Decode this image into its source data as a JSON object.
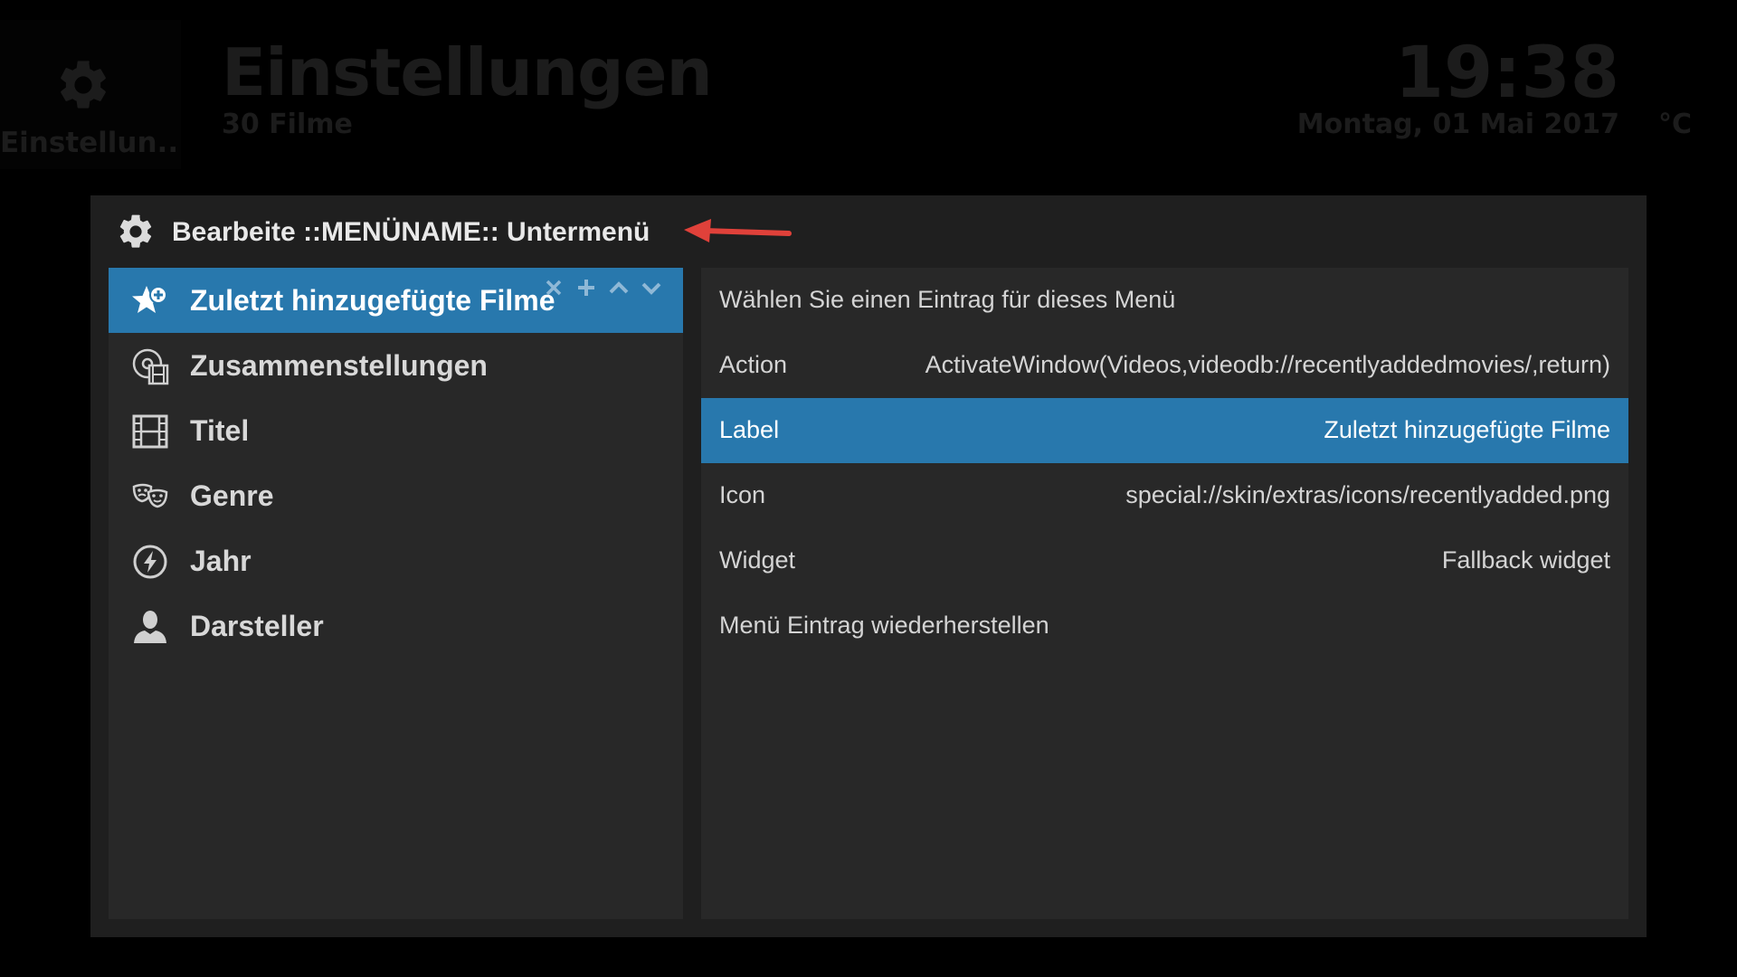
{
  "background": {
    "tile_icon": "gear-icon",
    "tile_label": "Einstellun...",
    "title": "Einstellungen",
    "subtitle": "30 Filme",
    "clock": "19:38",
    "date": "Montag, 01 Mai 2017",
    "temperature": "°C"
  },
  "dialog": {
    "icon": "gear-icon",
    "title": "Bearbeite ::MENÜNAME:: Untermenü",
    "annotation": "red-arrow-pointing-left"
  },
  "menu": {
    "selected_index": 0,
    "item_actions": [
      "×",
      "+",
      "˄",
      "˅"
    ],
    "items": [
      {
        "label": "Zuletzt hinzugefügte Filme",
        "icon": "star-plus-icon"
      },
      {
        "label": "Zusammenstellungen",
        "icon": "movie-set-icon"
      },
      {
        "label": "Titel",
        "icon": "film-strip-icon"
      },
      {
        "label": "Genre",
        "icon": "theater-masks-icon"
      },
      {
        "label": "Jahr",
        "icon": "year-clock-icon"
      },
      {
        "label": "Darsteller",
        "icon": "person-icon"
      }
    ]
  },
  "settings": {
    "selected_index": 2,
    "rows": [
      {
        "label": "Wählen Sie einen Eintrag für dieses Menü",
        "value": ""
      },
      {
        "label": "Action",
        "value": "ActivateWindow(Videos,videodb://recentlyaddedmovies/,return)"
      },
      {
        "label": "Label",
        "value": "Zuletzt hinzugefügte Filme"
      },
      {
        "label": "Icon",
        "value": "special://skin/extras/icons/recentlyadded.png"
      },
      {
        "label": "Widget",
        "value": "Fallback widget"
      },
      {
        "label": "Menü Eintrag wiederherstellen",
        "value": ""
      }
    ]
  },
  "colors": {
    "accent": "#2878ad",
    "panel": "#282828",
    "dialog": "#1f1f1f",
    "annotation_arrow": "#e0413a"
  }
}
